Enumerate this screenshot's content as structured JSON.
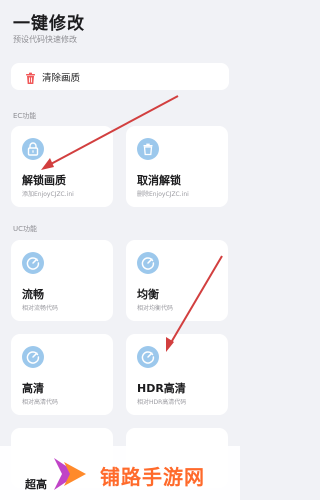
{
  "header": {
    "title": "一键修改",
    "subtitle": "预设代码快速修改"
  },
  "clear_item": {
    "icon": "trash-icon",
    "label": "清除画质"
  },
  "ec_section": {
    "label": "EC功能",
    "items": [
      {
        "name": "解锁画质",
        "desc": "添加EnjoyCJZC.ini",
        "icon": "lock-icon"
      },
      {
        "name": "取消解锁",
        "desc": "删除EnjoyCJZC.ini",
        "icon": "trash-icon"
      }
    ]
  },
  "uc_section": {
    "label": "UC功能",
    "items": [
      {
        "name": "流畅",
        "desc": "相对流畅代码",
        "icon": "gauge-icon"
      },
      {
        "name": "均衡",
        "desc": "相对均衡代码",
        "icon": "gauge-icon"
      },
      {
        "name": "高清",
        "desc": "相对高清代码",
        "icon": "gauge-icon"
      },
      {
        "name": "HDR高清",
        "desc": "相对HDR高清代码",
        "icon": "gauge-icon"
      }
    ],
    "peek_item": "超高"
  },
  "watermark": {
    "text": "铺路手游网",
    "icon": "brand-logo-icon"
  },
  "colors": {
    "accent": "#d23f3f",
    "icon_bg": "#9cc8ec",
    "brand": "#ff6a2b"
  }
}
